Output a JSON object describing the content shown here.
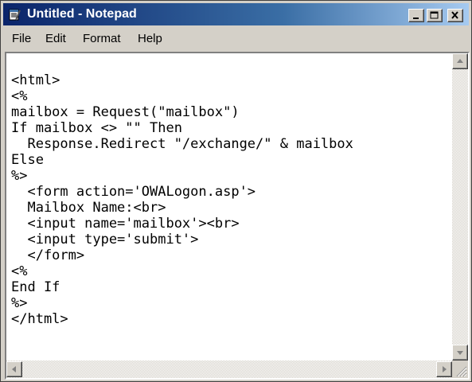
{
  "window": {
    "title": "Untitled - Notepad",
    "icon": "notepad-icon"
  },
  "caption_buttons": [
    "minimize-icon",
    "maximize-icon",
    "close-icon"
  ],
  "menu": {
    "items": [
      {
        "label": "File"
      },
      {
        "label": "Edit"
      },
      {
        "label": "Format"
      },
      {
        "label": "Help"
      }
    ]
  },
  "editor": {
    "lines": [
      "<html>",
      "<%",
      "mailbox = Request(\"mailbox\")",
      "If mailbox <> \"\" Then",
      "  Response.Redirect \"/exchange/\" & mailbox",
      "Else",
      "%>",
      "  <form action='OWALogon.asp'>",
      "  Mailbox Name:<br>",
      "  <input name='mailbox'><br>",
      "  <input type='submit'>",
      "  </form>",
      "<%",
      "End If",
      "%>",
      "</html>"
    ]
  },
  "colors": {
    "titlebar_start": "#0a246a",
    "titlebar_end": "#a6caf0",
    "chrome": "#d4d0c8"
  }
}
